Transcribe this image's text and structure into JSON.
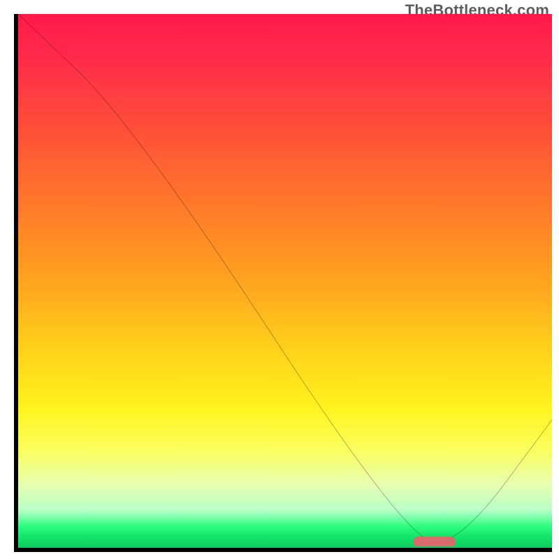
{
  "watermark": "TheBottleneck.com",
  "colors": {
    "axis": "#000000",
    "gradient_top": "#ff1a4b",
    "gradient_bottom": "#10c95f",
    "curve": "#000000",
    "optimum_bar": "#d86b6d"
  },
  "chart_data": {
    "type": "line",
    "title": "",
    "xlabel": "",
    "ylabel": "",
    "xlim": [
      0,
      100
    ],
    "ylim": [
      0,
      100
    ],
    "x": [
      0,
      22,
      73,
      83,
      100
    ],
    "values": [
      100,
      79,
      1,
      1,
      24
    ],
    "annotations": [
      {
        "name": "optimum-range-bar",
        "x_start": 74,
        "x_end": 82,
        "y": 0.5,
        "color": "#d86b6d"
      }
    ],
    "background_gradient": {
      "type": "vertical",
      "stops": [
        {
          "pos": 0,
          "color": "#ff1a4b"
        },
        {
          "pos": 50,
          "color": "#ffa31f"
        },
        {
          "pos": 80,
          "color": "#fbff62"
        },
        {
          "pos": 100,
          "color": "#10c95f"
        }
      ]
    }
  }
}
